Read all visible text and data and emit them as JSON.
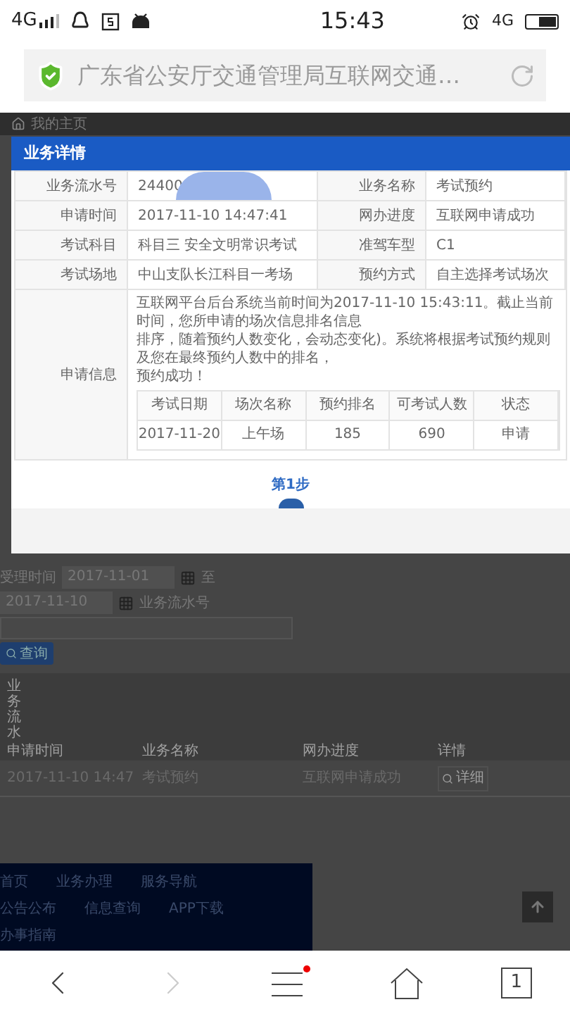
{
  "status_bar": {
    "network": "4G",
    "time": "15:43",
    "network_right": "4G"
  },
  "address_bar": {
    "title": "广东省公安厅交通管理局互联网交通…"
  },
  "page": {
    "header": "我的主页",
    "form": {
      "date_label": "受理时间",
      "date_from": "2017-11-01",
      "to_label": "至",
      "date_to": "2017-11-10",
      "number_label": "业务流水号",
      "search_button": "查询"
    },
    "table": {
      "side_label": "业务流水",
      "columns": [
        "申请时间",
        "业务名称",
        "网办进度",
        "详情"
      ],
      "rows": [
        {
          "cells": [
            "2017-11-10 14:47",
            "考试预约",
            "互联网申请成功"
          ],
          "button": "详细"
        }
      ]
    },
    "footer_links": [
      [
        "首页",
        "业务办理",
        "服务导航"
      ],
      [
        "公告公布",
        "信息查询",
        "APP下载"
      ],
      [
        "办事指南"
      ]
    ]
  },
  "dialog": {
    "title": "业务详情",
    "rows": [
      [
        {
          "label": "业务流水号",
          "value": "24400"
        },
        {
          "label": "业务名称",
          "value": "考试预约"
        }
      ],
      [
        {
          "label": "申请时间",
          "value": "2017-11-10 14:47:41"
        },
        {
          "label": "网办进度",
          "value": "互联网申请成功"
        }
      ],
      [
        {
          "label": "考试科目",
          "value": "科目三 安全文明常识考试"
        },
        {
          "label": "准驾车型",
          "value": "C1"
        }
      ],
      [
        {
          "label": "考试场地",
          "value": "中山支队长江科目一考场"
        },
        {
          "label": "预约方式",
          "value": "自主选择考试场次"
        }
      ]
    ],
    "info": {
      "label": "申请信息",
      "lines": [
        "互联网平台后台系统当前时间为2017-11-10 15:43:11。截止当前时间，您所申请的场次信息排名信息",
        "排序，随着预约人数变化，会动态变化)。系统将根据考试预约规则及您在最终预约人数中的排名，",
        "预约成功！"
      ],
      "table": {
        "columns": [
          "考试日期",
          "场次名称",
          "预约排名",
          "可考试人数",
          "状态"
        ],
        "rows": [
          [
            "2017-11-20",
            "上午场",
            "185",
            "690",
            "申请"
          ]
        ]
      }
    },
    "step": "第1步"
  },
  "browser_toolbar": {
    "forward_disabled": true,
    "menu_notification": true,
    "tab_count": "1"
  }
}
